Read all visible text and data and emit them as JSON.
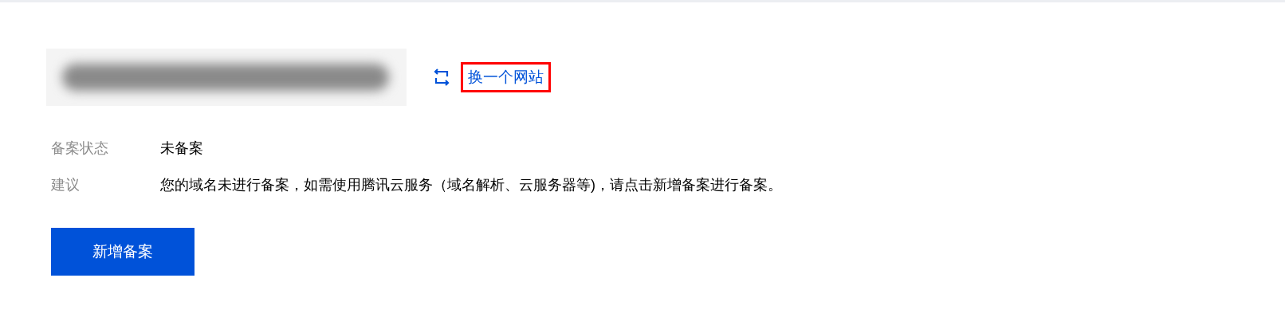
{
  "switch_link": {
    "label": "换一个网站",
    "highlighted": true
  },
  "details": [
    {
      "label": "备案状态",
      "value": "未备案"
    },
    {
      "label": "建议",
      "value": "您的域名未进行备案，如需使用腾讯云服务（域名解析、云服务器等)，请点击新增备案进行备案。"
    }
  ],
  "primary_button": "新增备案"
}
